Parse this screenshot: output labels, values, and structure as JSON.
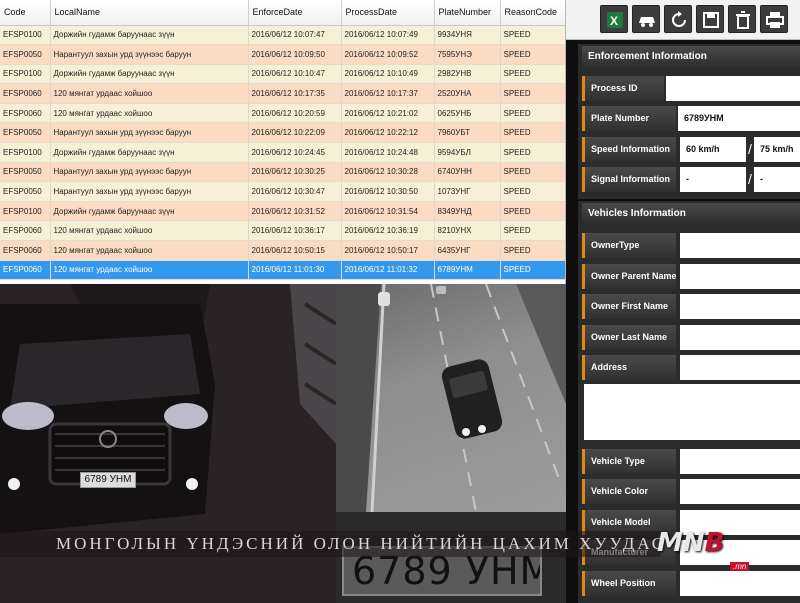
{
  "table": {
    "columns": [
      "Code",
      "LocalName",
      "EnforceDate",
      "ProcessDate",
      "PlateNumber",
      "ReasonCode"
    ],
    "rows": [
      [
        "EFSP0100",
        "Доржийн гудамж баруунаас зүүн",
        "2016/06/12 10:07:47",
        "2016/06/12 10:07:49",
        "9934УНЯ",
        "SPEED"
      ],
      [
        "EFSP0050",
        "Нарантуул захын урд зүүнээс баруун",
        "2016/06/12 10:09:50",
        "2016/06/12 10:09:52",
        "7595УНЭ",
        "SPEED"
      ],
      [
        "EFSP0100",
        "Доржийн гудамж баруунаас зүүн",
        "2016/06/12 10:10:47",
        "2016/06/12 10:10:49",
        "2982УНВ",
        "SPEED"
      ],
      [
        "EFSP0060",
        "120 мянгат урдаас хойшоо",
        "2016/06/12 10:17:35",
        "2016/06/12 10:17:37",
        "2520УНА",
        "SPEED"
      ],
      [
        "EFSP0060",
        "120 мянгат урдаас хойшоо",
        "2016/06/12 10:20:59",
        "2016/06/12 10:21:02",
        "0625УНБ",
        "SPEED"
      ],
      [
        "EFSP0050",
        "Нарантуул захын урд зүүнээс баруун",
        "2016/06/12 10:22:09",
        "2016/06/12 10:22:12",
        "7960УБТ",
        "SPEED"
      ],
      [
        "EFSP0100",
        "Доржийн гудамж баруунаас зүүн",
        "2016/06/12 10:24:45",
        "2016/06/12 10:24:48",
        "9594УБЛ",
        "SPEED"
      ],
      [
        "EFSP0050",
        "Нарантуул захын урд зүүнээс баруун",
        "2016/06/12 10:30:25",
        "2016/06/12 10:30:28",
        "6740УНН",
        "SPEED"
      ],
      [
        "EFSP0050",
        "Нарантуул захын урд зүүнээс баруун",
        "2016/06/12 10:30:47",
        "2016/06/12 10:30:50",
        "1073УНГ",
        "SPEED"
      ],
      [
        "EFSP0100",
        "Доржийн гудамж баруунаас зүүн",
        "2016/06/12 10:31:52",
        "2016/06/12 10:31:54",
        "8349УНД",
        "SPEED"
      ],
      [
        "EFSP0060",
        "120 мянгат урдаас хойшоо",
        "2016/06/12 10:36:17",
        "2016/06/12 10:36:19",
        "8210УНХ",
        "SPEED"
      ],
      [
        "EFSP0060",
        "120 мянгат урдаас хойшоо",
        "2016/06/12 10:50:15",
        "2016/06/12 10:50:17",
        "6435УНГ",
        "SPEED"
      ],
      [
        "EFSP0060",
        "120 мянгат урдаас хойшоо",
        "2016/06/12 11:01:30",
        "2016/06/12 11:01:32",
        "6789УНМ",
        "SPEED"
      ]
    ],
    "selected_index": 12
  },
  "toolbar": {
    "icons": [
      "excel-icon",
      "car-icon",
      "refresh-icon",
      "save-icon",
      "trash-icon",
      "print-icon"
    ]
  },
  "enforcement": {
    "title": "Enforcement Information",
    "process_id_label": "Process ID",
    "process_id_value": "",
    "plate_label": "Plate Number",
    "plate_value": "6789УНМ",
    "speed_label": "Speed Information",
    "speed_value": "60 km/h",
    "speed_limit_value": "75 km/h",
    "signal_label": "Signal Information",
    "signal_value_1": "-",
    "signal_value_2": "-",
    "separator": "/"
  },
  "vehicles": {
    "title": "Vehicles Information",
    "owner_type_label": "OwnerType",
    "owner_parent_label": "Owner Parent Name",
    "owner_first_label": "Owner First Name",
    "owner_last_label": "Owner Last Name",
    "address_label": "Address",
    "vehicle_type_label": "Vehicle Type",
    "vehicle_color_label": "Vehicle Color",
    "vehicle_model_label": "Vehicle Model",
    "manufacturer_label": "Manufacturer",
    "wheel_position_label": "Wheel Position"
  },
  "camera": {
    "front_plate_text": "6789 УНМ",
    "closeup_plate_text": "6789 УНМ"
  },
  "overlay": {
    "banner_text": "МОНГОЛЫН ҮНДЭСНИЙ ОЛОН НИЙТИЙН ЦАХИМ ХУУДАС",
    "logo_text_1": "MN",
    "logo_text_2": "B",
    "logo_sub": ".mn"
  },
  "colors": {
    "row_odd": "#f7efd6",
    "row_even": "#fbdcc3",
    "row_selected": "#3399ee",
    "label_accent": "#e08a14",
    "logo_red": "#c8102e"
  }
}
